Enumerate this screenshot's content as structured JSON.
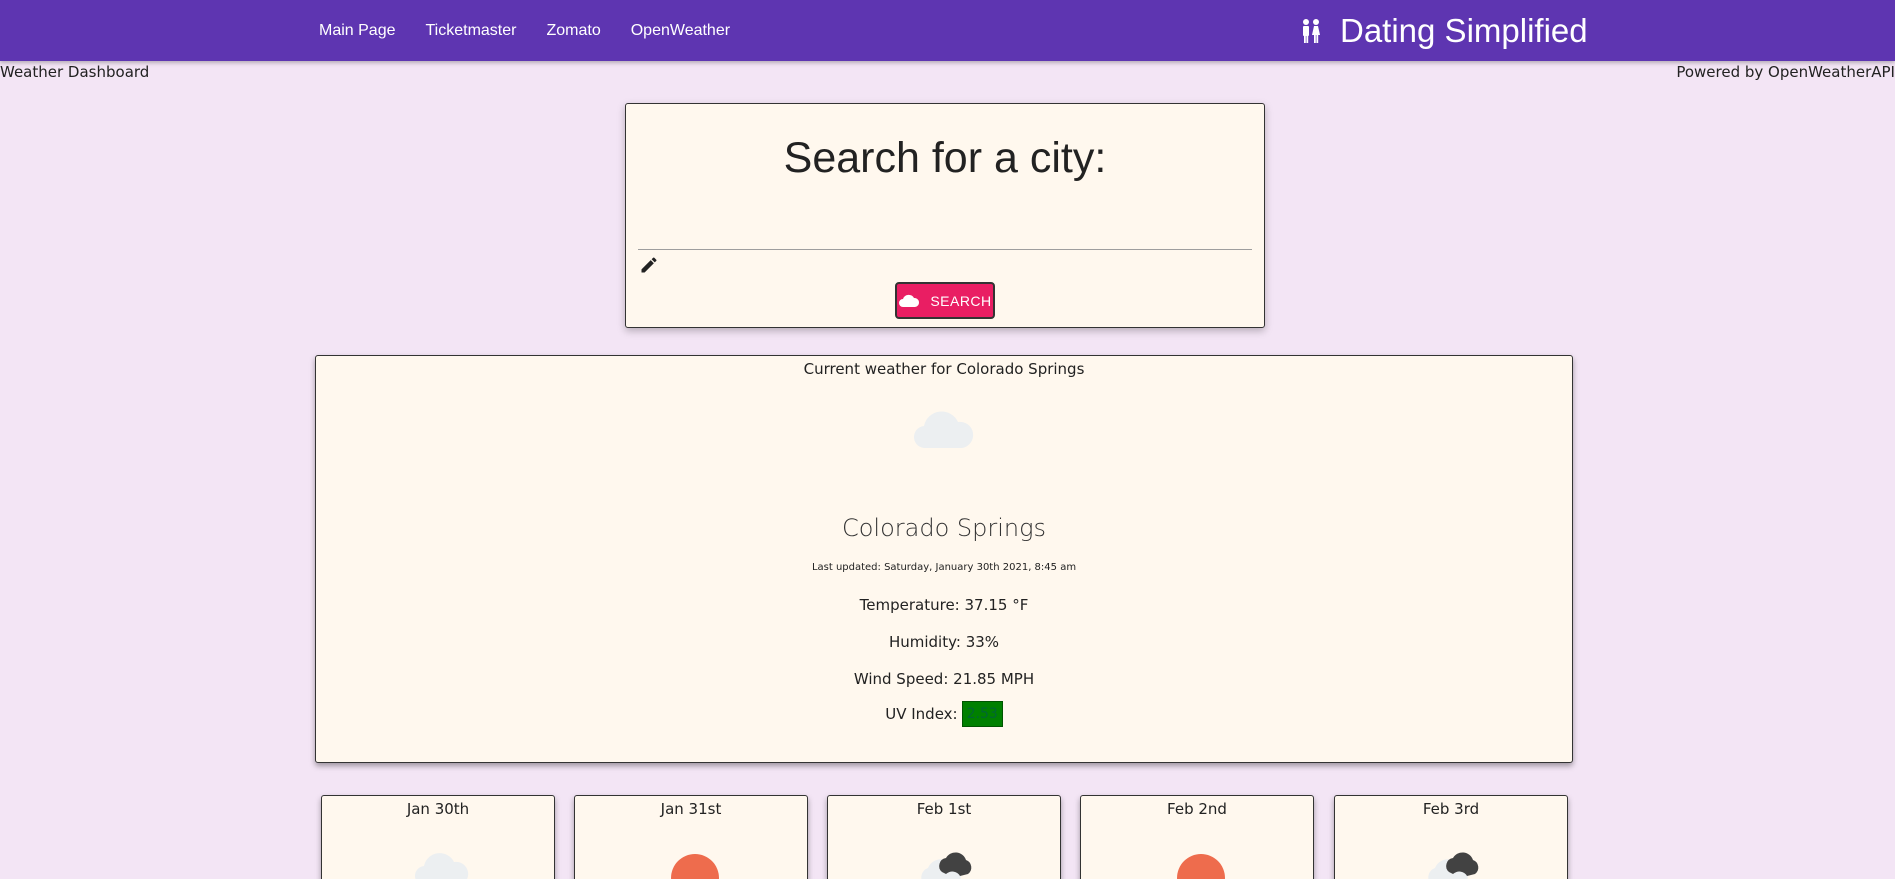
{
  "nav": {
    "links": [
      "Main Page",
      "Ticketmaster",
      "Zomato",
      "OpenWeather"
    ],
    "brand": "Dating Simplified"
  },
  "subheader": {
    "left": "Weather Dashboard",
    "right": "Powered by OpenWeatherAPI"
  },
  "search": {
    "title": "Search for a city:",
    "input_value": "",
    "button_label": "SEARCH"
  },
  "current": {
    "heading": "Current weather for Colorado Springs",
    "icon": "cloud-icon",
    "city": "Colorado Springs",
    "updated": "Last updated: Saturday, January 30th 2021, 8:45 am",
    "temperature": "Temperature: 37.15 °F",
    "humidity": "Humidity: 33%",
    "wind": "Wind Speed: 21.85 MPH",
    "uv_label": "UV Index:",
    "uv_value": "2.53",
    "uv_color": "#008000"
  },
  "forecast": [
    {
      "date": "Jan 30th",
      "icon": "cloud-icon"
    },
    {
      "date": "Jan 31st",
      "icon": "sun-icon"
    },
    {
      "date": "Feb 1st",
      "icon": "broken-clouds-icon"
    },
    {
      "date": "Feb 2nd",
      "icon": "sun-icon"
    },
    {
      "date": "Feb 3rd",
      "icon": "broken-clouds-icon"
    }
  ],
  "colors": {
    "navbar": "#5e35b1",
    "background": "#f3e5f5",
    "card": "#fff8ee",
    "button": "#e91e63",
    "sun": "#ee6c4d"
  }
}
